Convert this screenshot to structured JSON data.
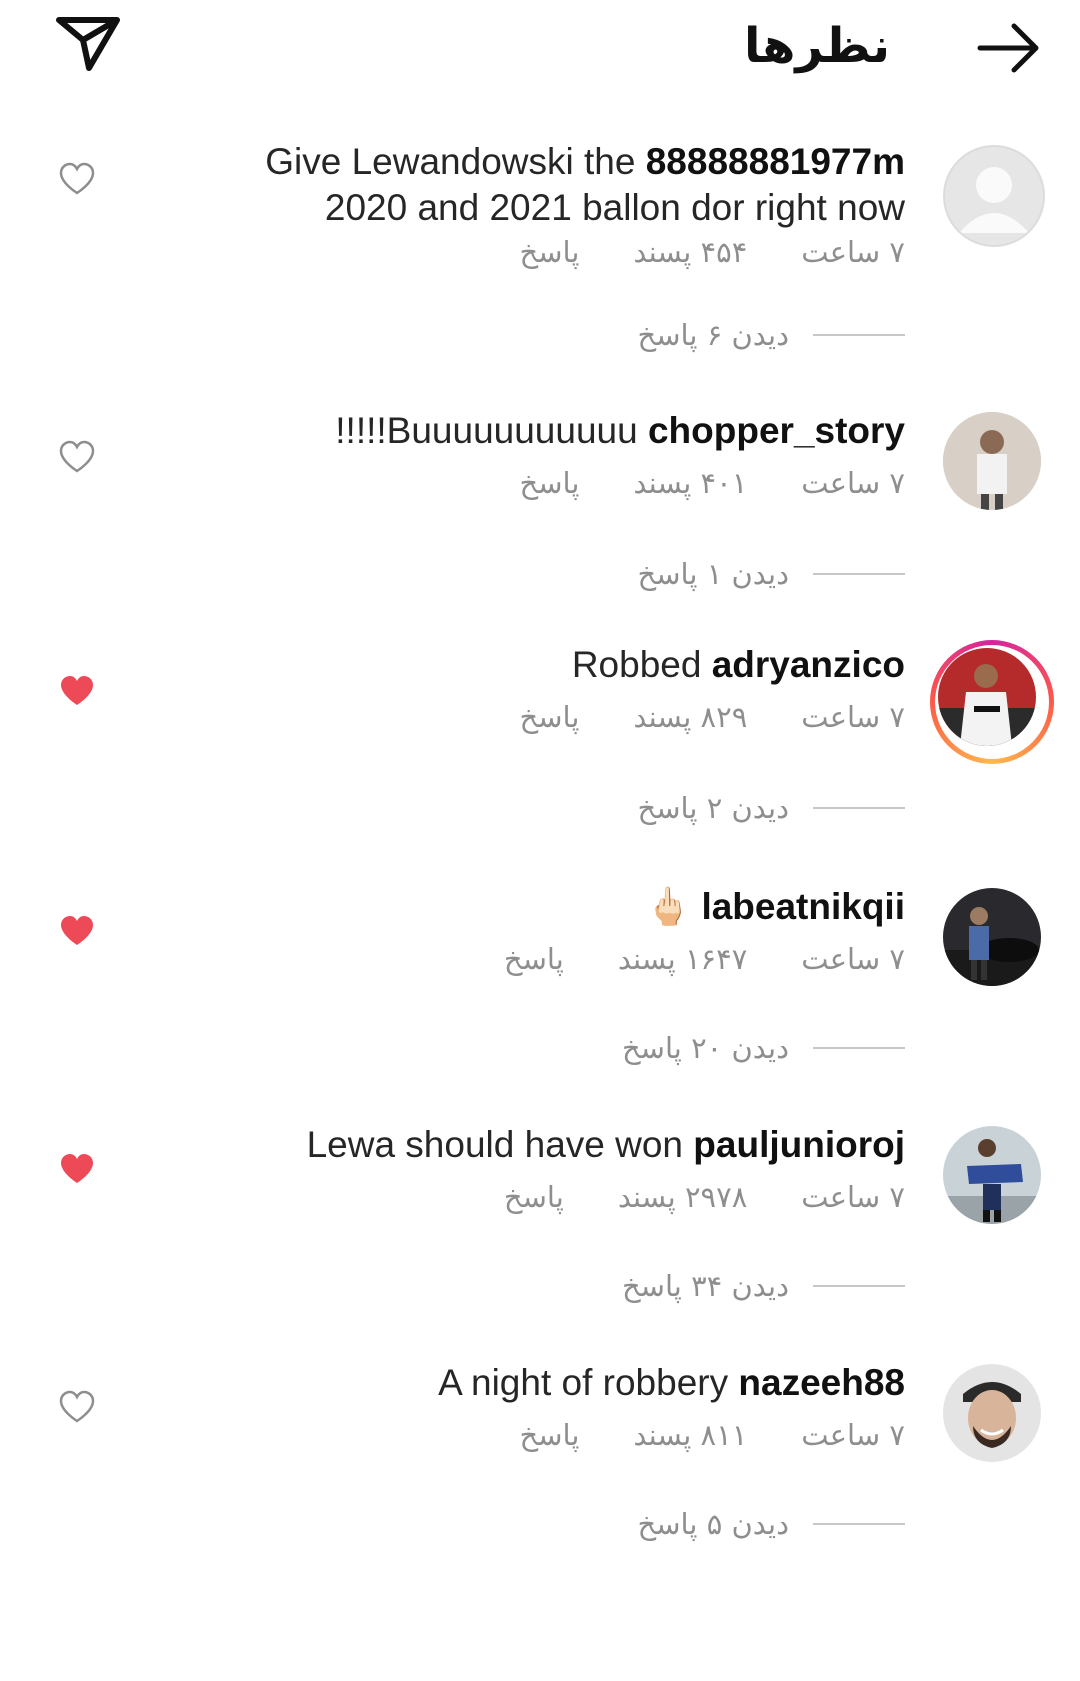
{
  "header": {
    "title": "نظرها",
    "icons": [
      "send-icon",
      "arrow-right-icon"
    ]
  },
  "colors": {
    "liked_heart": "#ed4956",
    "meta_text": "#8e8e8e"
  },
  "comments": [
    {
      "username": "",
      "text": "Give Lewandowski the 88888881977m 2020 and 2021 ballon dor right now",
      "bold_part": "88888881977m",
      "time": "۷ ساعت",
      "likes": "۴۵۴ پسند",
      "reply": "پاسخ",
      "view_replies": "دیدن ۶ پاسخ",
      "liked": false
    },
    {
      "username": "chopper_story",
      "text": "!!!!!Buuuuuuuuuuu",
      "time": "۷ ساعت",
      "likes": "۴۰۱ پسند",
      "reply": "پاسخ",
      "view_replies": "دیدن ۱ پاسخ",
      "liked": false
    },
    {
      "username": "adryanzico",
      "text": "Robbed",
      "time": "۷ ساعت",
      "likes": "۸۲۹ پسند",
      "reply": "پاسخ",
      "view_replies": "دیدن ۲ پاسخ",
      "liked": true
    },
    {
      "username": "labeatnikqii",
      "text": "🖕🏻",
      "time": "۷ ساعت",
      "likes": "۱۶۴۷ پسند",
      "reply": "پاسخ",
      "view_replies": "دیدن ۲۰ پاسخ",
      "liked": true
    },
    {
      "username": "pauljunioroj",
      "text": "Lewa should have won",
      "time": "۷ ساعت",
      "likes": "۲۹۷۸ پسند",
      "reply": "پاسخ",
      "view_replies": "دیدن ۳۴ پاسخ",
      "liked": true
    },
    {
      "username": "nazeeh88",
      "text": "A night of robbery",
      "time": "۷ ساعت",
      "likes": "۸۱۱ پسند",
      "reply": "پاسخ",
      "view_replies": "دیدن ۵ پاسخ",
      "liked": false
    }
  ]
}
